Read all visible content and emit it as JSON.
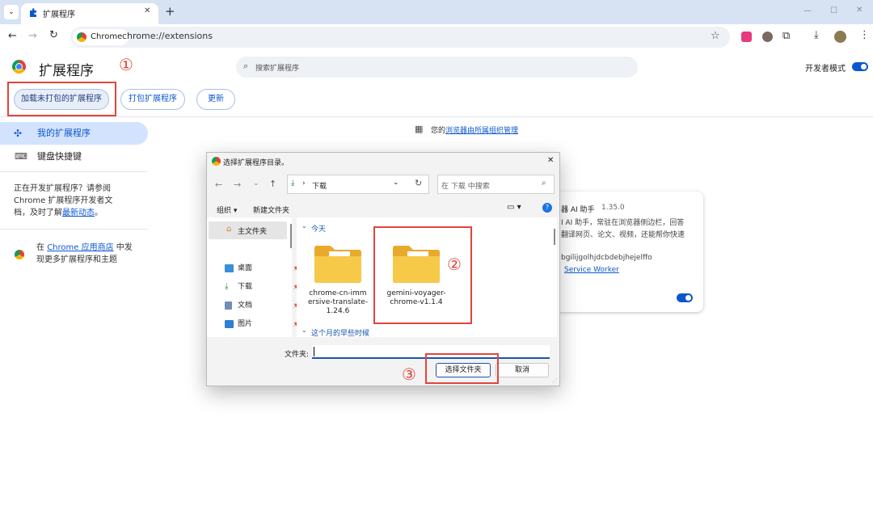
{
  "browser": {
    "tab_title": "扩展程序",
    "new_tab": "+",
    "window_controls": {
      "minimize": "—",
      "maximize": "☐",
      "close": "✕"
    },
    "site_chip": "Chrome",
    "url": "chrome://extensions"
  },
  "header": {
    "title": "扩展程序",
    "search_placeholder": "搜索扩展程序",
    "dev_mode_label": "开发者模式",
    "dev_mode_on": true
  },
  "actions": {
    "load_unpacked": "加载未打包的扩展程序",
    "pack": "打包扩展程序",
    "update": "更新"
  },
  "sidebar": {
    "items": [
      {
        "label": "我的扩展程序",
        "active": true
      },
      {
        "label": "键盘快捷键",
        "active": false
      }
    ],
    "dev_note_pre": "正在开发扩展程序？请参阅 Chrome 扩展程序开发者文档，及时了解",
    "dev_note_link": "最新动态",
    "dev_note_post": "。",
    "store_pre": "在",
    "store_link": "Chrome 应用商店",
    "store_post": "中发现更多扩展程序和主题"
  },
  "managed": {
    "pre": "您的",
    "link": "浏览器由所属组织管理"
  },
  "extension_card": {
    "name_partial": "器 AI 助手",
    "version": "1.35.0",
    "desc_line1": "I AI 助手，常驻在浏览器侧边栏，回答",
    "desc_line2": "翻译网页、论文、视频，还能帮你快速",
    "id_partial": "bgilijgolhjdcbdebjhejelffo",
    "service_worker": "Service Worker",
    "enabled": true
  },
  "annotations": [
    "①",
    "②",
    "③"
  ],
  "dialog": {
    "title": "选择扩展程序目录。",
    "path_item": "下载",
    "search_placeholder": "在 下载 中搜索",
    "organize": "组织 ▾",
    "new_folder": "新建文件夹",
    "sidebar": {
      "home": "主文件夹",
      "items": [
        "桌面",
        "下载",
        "文档",
        "图片"
      ]
    },
    "group_today": "今天",
    "group_earlier": "这个月的早些时候",
    "files": [
      {
        "name": "chrome-cn-immersive-translate-1.24.6"
      },
      {
        "name": "gemini-voyager-chrome-v1.1.4"
      }
    ],
    "folder_label": "文件夹:",
    "select_button": "选择文件夹",
    "cancel_button": "取消"
  },
  "colors": {
    "accent": "#0b57d0",
    "annotation": "#e0453b",
    "folder": "#f5c542",
    "active_nav": "#d3e3fd"
  }
}
